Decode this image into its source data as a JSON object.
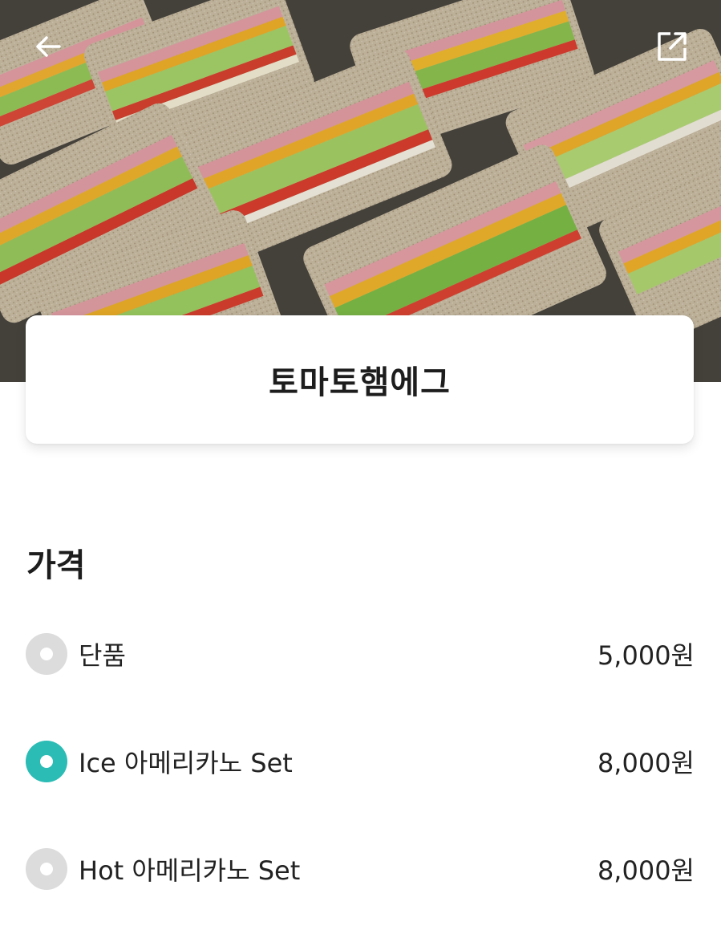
{
  "product": {
    "image_description": "",
    "name": "토마토햄에그"
  },
  "price_section": {
    "title": "가격",
    "options": [
      {
        "label": "단품",
        "price": "5,000원",
        "selected": false
      },
      {
        "label": "Ice 아메리카노 Set",
        "price": "8,000원",
        "selected": true
      },
      {
        "label": "Hot 아메리카노 Set",
        "price": "8,000원",
        "selected": false
      }
    ]
  },
  "icons": {
    "back": "arrow-left-icon",
    "share": "external-link-icon"
  },
  "colors": {
    "accent": "#2bbcb5",
    "radio_off": "#dcdcdc"
  }
}
